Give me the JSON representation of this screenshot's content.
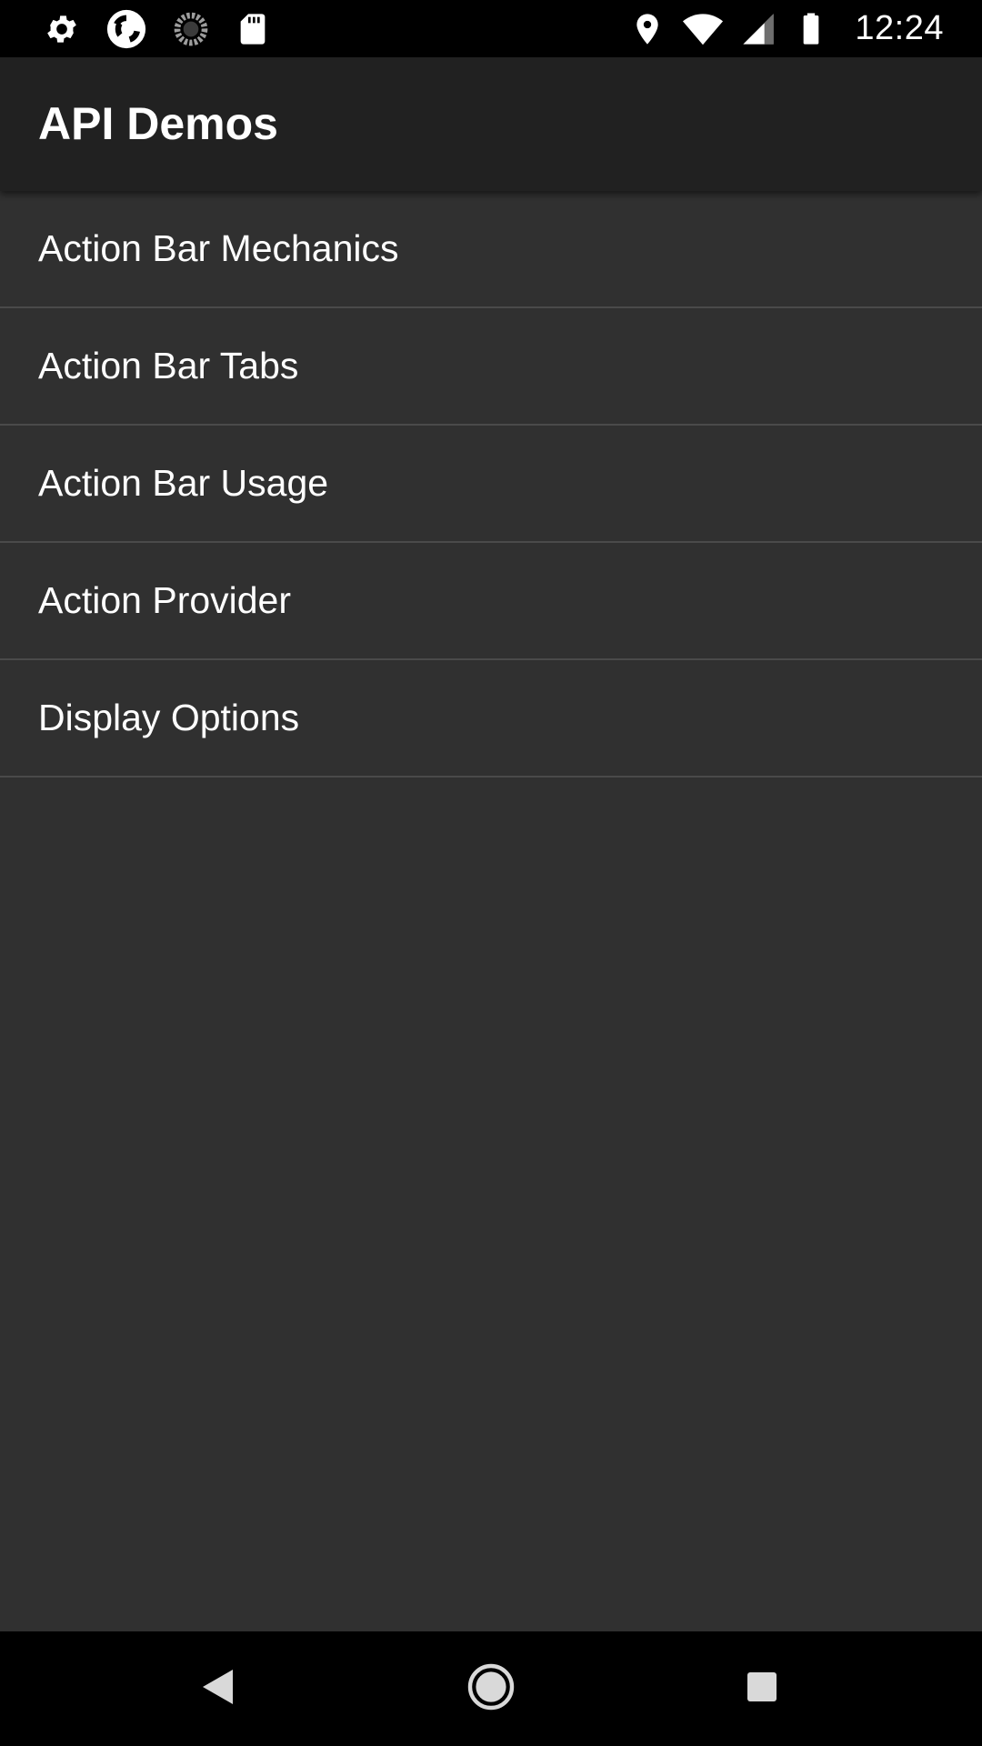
{
  "status_bar": {
    "time": "12:24",
    "left_icons": [
      "settings-icon",
      "app-logo-icon",
      "loading-icon",
      "sd-card-icon"
    ],
    "right_icons": [
      "location-icon",
      "wifi-icon",
      "cell-signal-icon",
      "battery-icon"
    ]
  },
  "app_bar": {
    "title": "API Demos"
  },
  "list": {
    "items": [
      {
        "label": "Action Bar Mechanics"
      },
      {
        "label": "Action Bar Tabs"
      },
      {
        "label": "Action Bar Usage"
      },
      {
        "label": "Action Provider"
      },
      {
        "label": "Display Options"
      }
    ]
  },
  "nav_bar": {
    "buttons": [
      "back-icon",
      "home-icon",
      "recents-icon"
    ]
  },
  "colors": {
    "background": "#303030",
    "app_bar": "#212121",
    "status_bar": "#000000",
    "divider": "#4a4a4a",
    "text": "#ffffff"
  }
}
